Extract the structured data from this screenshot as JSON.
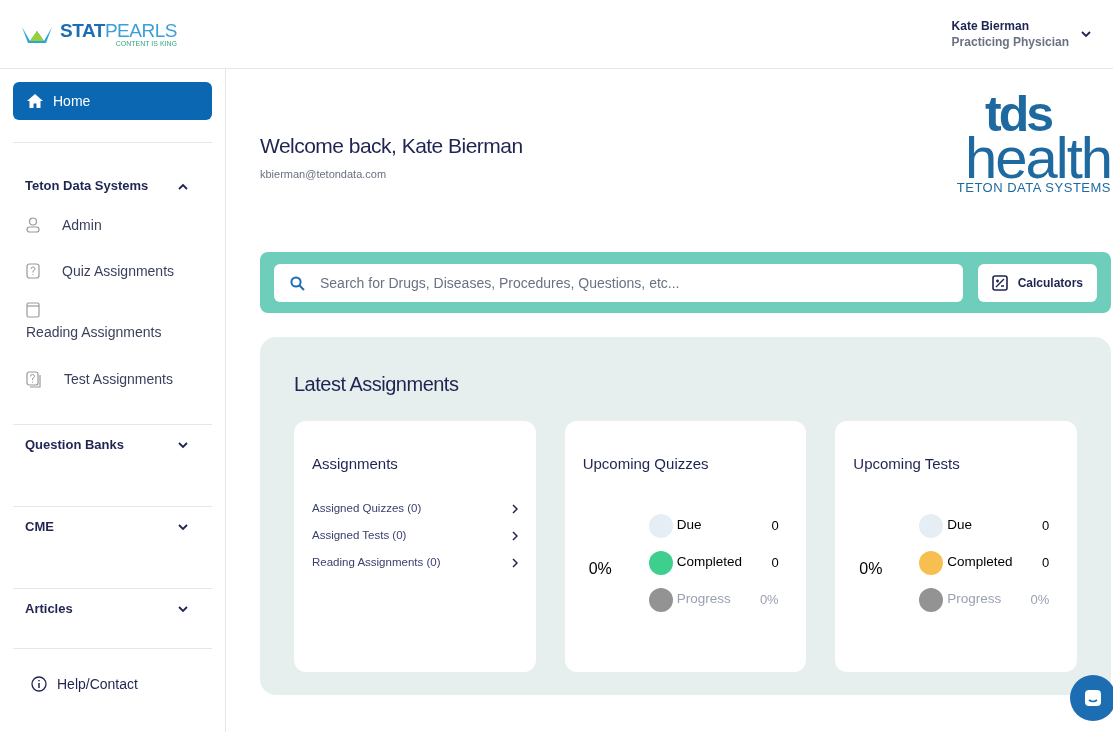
{
  "header": {
    "logo": {
      "brand_bold": "STAT",
      "brand_light": "PEARLS",
      "tagline": "CONTENT IS KING"
    },
    "user": {
      "name": "Kate Bierman",
      "role": "Practicing Physician"
    }
  },
  "sidebar": {
    "home": {
      "label": "Home",
      "selected": true
    },
    "sections": [
      {
        "title": "Teton Data Systems",
        "expanded": true,
        "items": [
          {
            "label": "Admin",
            "kind": "person"
          },
          {
            "label": "Quiz Assignments",
            "kind": "quiz"
          },
          {
            "label": "Reading Assignments",
            "kind": "reading"
          },
          {
            "label": "Test Assignments",
            "kind": "test"
          }
        ]
      },
      {
        "title": "Question Banks",
        "expanded": false
      },
      {
        "title": "CME",
        "expanded": false
      },
      {
        "title": "Articles",
        "expanded": false
      }
    ],
    "help": "Help/Contact"
  },
  "welcome": {
    "title": "Welcome back, Kate Bierman",
    "email": "kbierman@tetondata.com"
  },
  "partner_logo": {
    "top": "tds",
    "bottom": "health",
    "caption": "TETON DATA SYSTEMS"
  },
  "search": {
    "placeholder": "Search for Drugs, Diseases, Procedures, Questions, etc...",
    "calculators": "Calculators"
  },
  "latest": {
    "title": "Latest Assignments",
    "assignments": {
      "title": "Assignments",
      "links": [
        "Assigned Quizzes (0)",
        "Assigned Tests (0)",
        "Reading Assignments (0)"
      ]
    },
    "stats": [
      {
        "title": "Upcoming Quizzes",
        "percent": "0%",
        "legend": [
          {
            "label": "Due",
            "value": "0",
            "color": "#e6eef5"
          },
          {
            "label": "Completed",
            "value": "0",
            "color": "#3ecf8e"
          },
          {
            "label": "Progress",
            "value": "0%",
            "color": "#939393"
          }
        ]
      },
      {
        "title": "Upcoming Tests",
        "percent": "0%",
        "legend": [
          {
            "label": "Due",
            "value": "0",
            "color": "#e6eef5"
          },
          {
            "label": "Completed",
            "value": "0",
            "color": "#f7bf50"
          },
          {
            "label": "Progress",
            "value": "0%",
            "color": "#939393"
          }
        ]
      }
    ]
  }
}
